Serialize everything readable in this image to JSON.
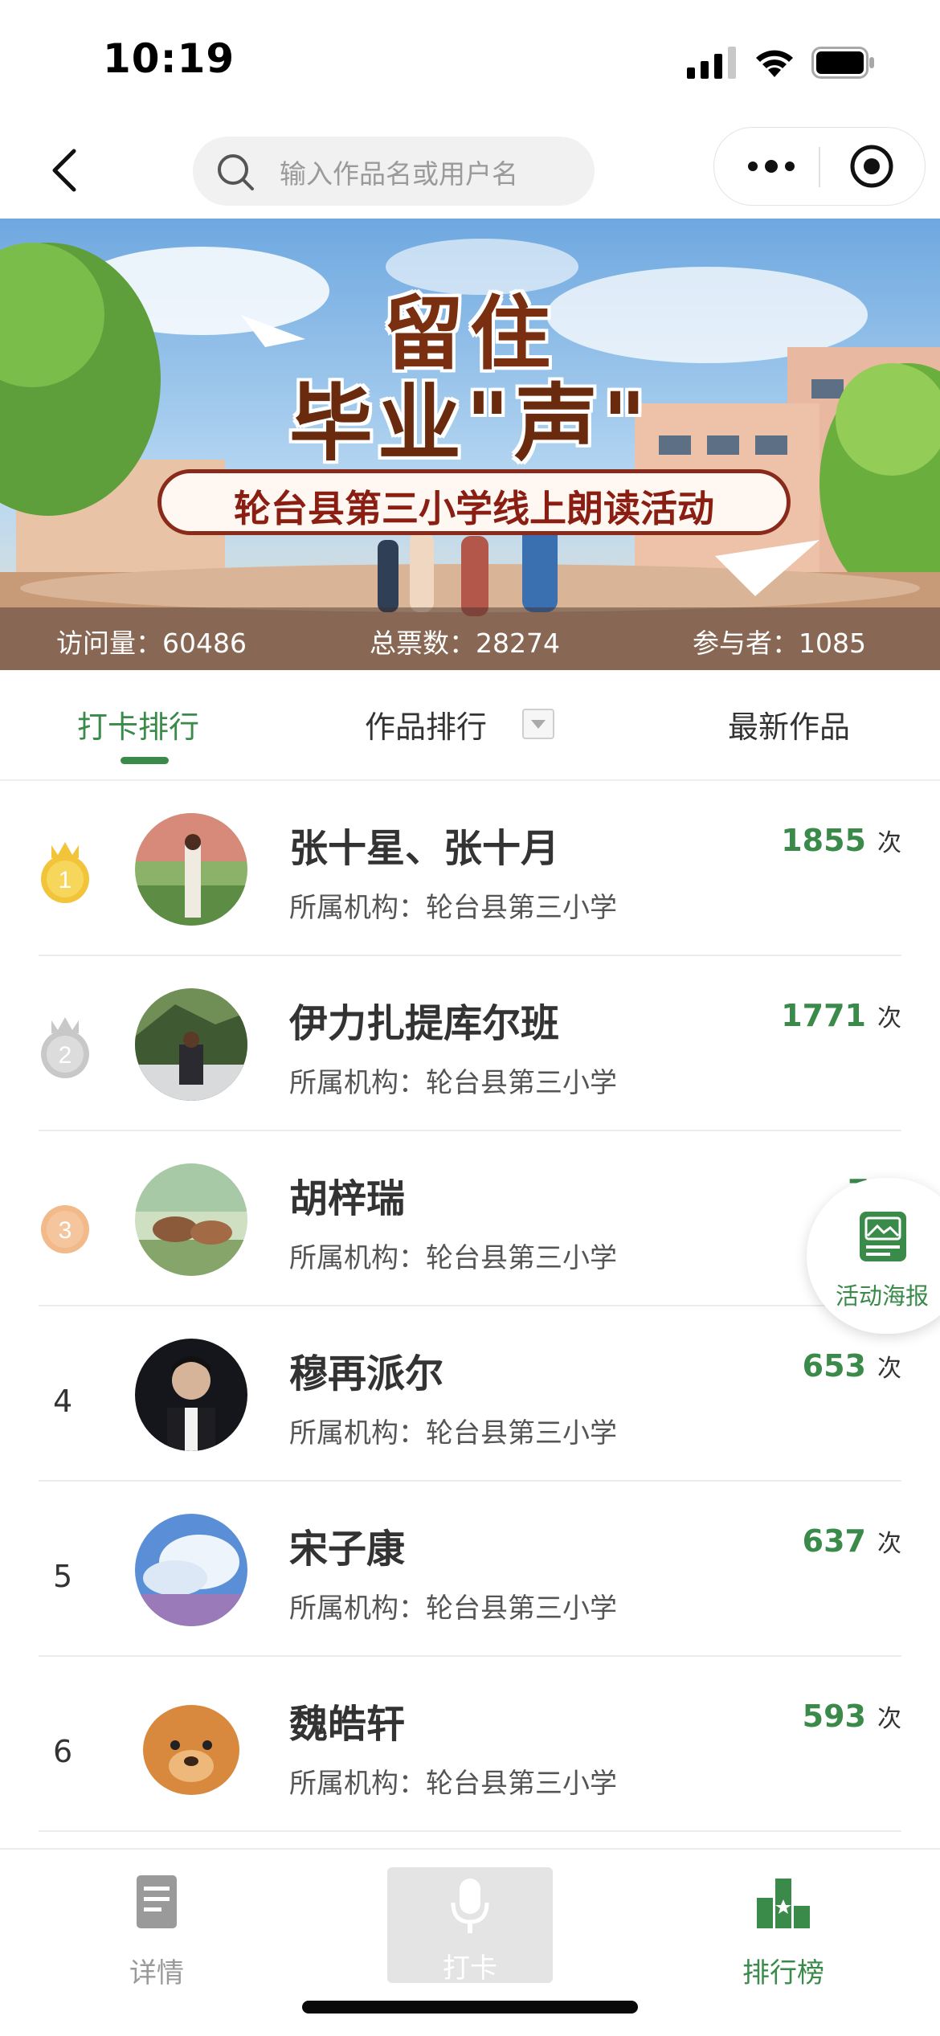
{
  "status_bar": {
    "time": "10:19"
  },
  "search": {
    "placeholder": "输入作品名或用户名"
  },
  "banner": {
    "title_line1": "留住",
    "title_line2": "毕业\"声\"",
    "subtitle": "轮台县第三小学线上朗读活动",
    "stats": {
      "visits": "访问量：60486",
      "votes": "总票数：28274",
      "participants": "参与者：1085"
    }
  },
  "tabs": [
    {
      "label": "打卡排行",
      "active": true
    },
    {
      "label": "作品排行",
      "active": false
    },
    {
      "label": "最新作品",
      "active": false
    }
  ],
  "ranking": [
    {
      "rank": "1",
      "name": "张十星、张十月",
      "org": "所属机构：轮台县第三小学",
      "count": "1855",
      "unit": "次"
    },
    {
      "rank": "2",
      "name": "伊力扎提库尔班",
      "org": "所属机构：轮台县第三小学",
      "count": "1771",
      "unit": "次"
    },
    {
      "rank": "3",
      "name": "胡梓瑞",
      "org": "所属机构：轮台县第三小学",
      "count": "71",
      "unit": ""
    },
    {
      "rank": "4",
      "name": "穆再派尔",
      "org": "所属机构：轮台县第三小学",
      "count": "653",
      "unit": "次"
    },
    {
      "rank": "5",
      "name": "宋子康",
      "org": "所属机构：轮台县第三小学",
      "count": "637",
      "unit": "次"
    },
    {
      "rank": "6",
      "name": "魏皓轩",
      "org": "所属机构：轮台县第三小学",
      "count": "593",
      "unit": "次"
    }
  ],
  "floating": {
    "poster_label": "活动海报"
  },
  "bottom_nav": [
    {
      "label": "详情",
      "icon": "document-icon",
      "active": false
    },
    {
      "label": "打卡",
      "icon": "microphone-icon",
      "active": false
    },
    {
      "label": "排行榜",
      "icon": "ranking-icon",
      "active": true
    }
  ],
  "colors": {
    "accent": "#3a8a4a",
    "gold": "#f2c43a",
    "silver": "#c8c8c8",
    "bronze": "#f2b98a"
  }
}
